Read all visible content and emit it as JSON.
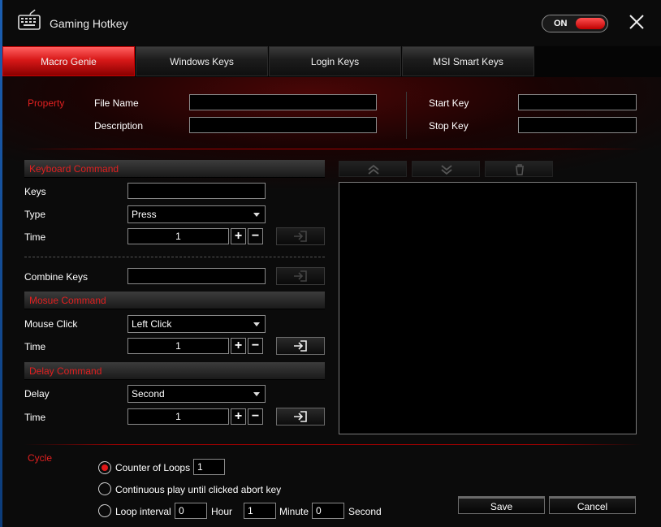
{
  "window": {
    "title": "Gaming Hotkey",
    "toggle_label": "ON"
  },
  "tabs": [
    {
      "label": "Macro Genie",
      "active": true
    },
    {
      "label": "Windows Keys",
      "active": false
    },
    {
      "label": "Login Keys",
      "active": false
    },
    {
      "label": "MSI Smart Keys",
      "active": false
    }
  ],
  "property": {
    "label": "Property",
    "file_name_label": "File Name",
    "file_name_value": "",
    "description_label": "Description",
    "description_value": "",
    "start_key_label": "Start Key",
    "start_key_value": "",
    "stop_key_label": "Stop Key",
    "stop_key_value": ""
  },
  "keyboard": {
    "header": "Keyboard Command",
    "keys_label": "Keys",
    "keys_value": "",
    "type_label": "Type",
    "type_value": "Press",
    "time_label": "Time",
    "time_value": "1",
    "combine_label": "Combine Keys",
    "combine_value": ""
  },
  "mouse": {
    "header": "Mosue Command",
    "click_label": "Mouse Click",
    "click_value": "Left Click",
    "time_label": "Time",
    "time_value": "1"
  },
  "delay": {
    "header": "Delay Command",
    "delay_label": "Delay",
    "delay_value": "Second",
    "time_label": "Time",
    "time_value": "1"
  },
  "cycle": {
    "label": "Cycle",
    "counter_label": "Counter of Loops",
    "counter_value": "1",
    "continuous_label": "Continuous play until clicked abort key",
    "interval_label": "Loop interval",
    "hour_value": "0",
    "hour_label": "Hour",
    "minute_value": "1",
    "minute_label": "Minute",
    "second_value": "0",
    "second_label": "Second",
    "selected": "counter"
  },
  "buttons": {
    "save": "Save",
    "cancel": "Cancel"
  },
  "colors": {
    "accent": "#e02020",
    "background": "#0b0b0b"
  },
  "icons": [
    "keyboard-icon",
    "close-icon",
    "move-up-icon",
    "move-down-icon",
    "trash-icon",
    "insert-icon",
    "chevron-down-icon"
  ]
}
